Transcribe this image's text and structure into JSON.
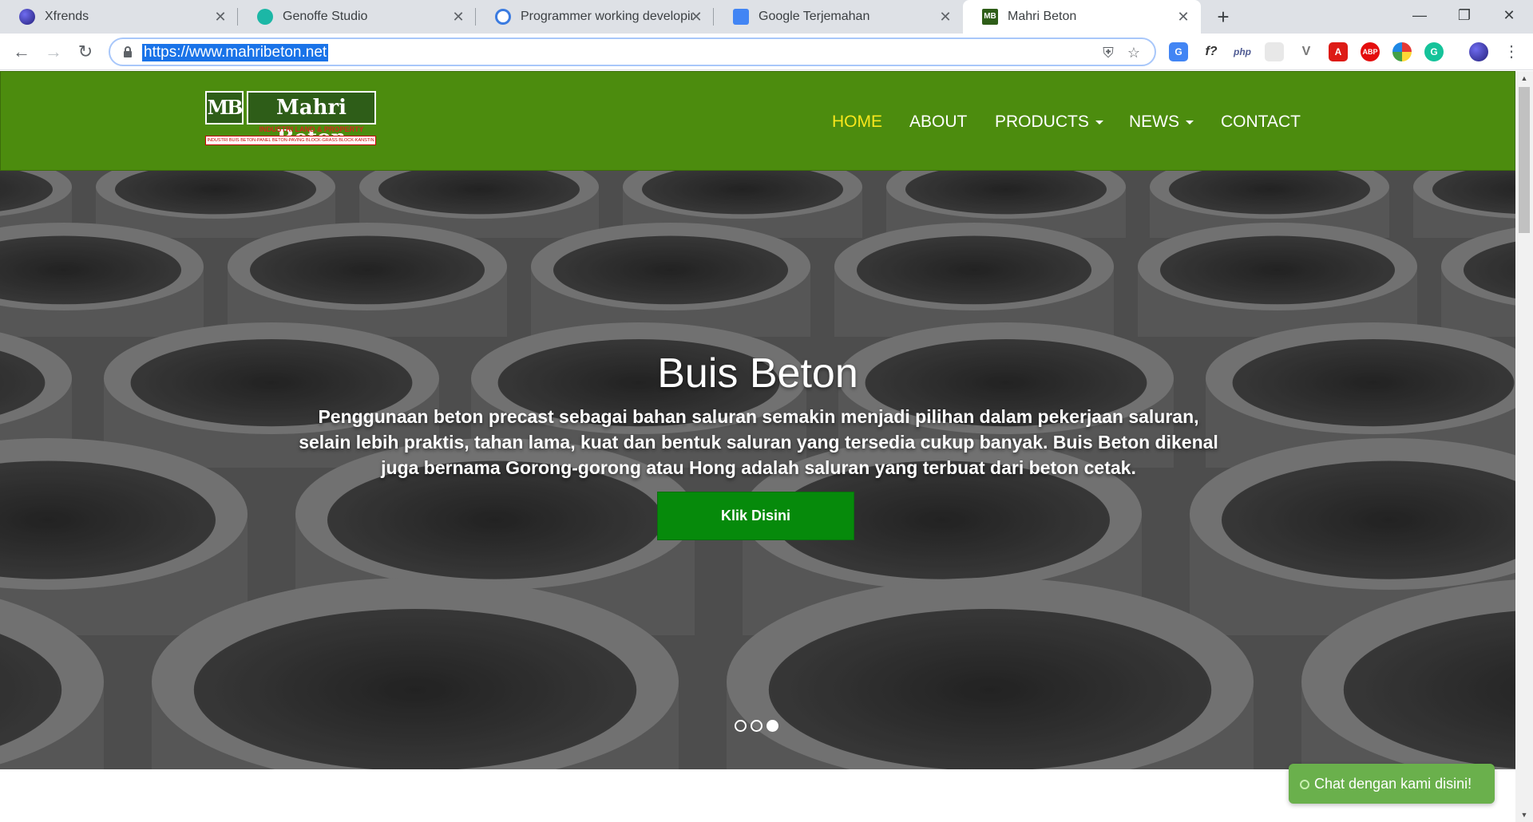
{
  "browser": {
    "tabs": [
      {
        "title": "Xfrends",
        "icon": "globe-icon",
        "active": false
      },
      {
        "title": "Genoffe Studio",
        "icon": "genoffe-icon",
        "active": false
      },
      {
        "title": "Programmer working developing",
        "icon": "gear-bug-icon",
        "active": false
      },
      {
        "title": "Google Terjemahan",
        "icon": "translate-icon",
        "active": false
      },
      {
        "title": "Mahri Beton",
        "icon": "mb-favicon",
        "active": true
      }
    ],
    "new_tab": "+",
    "window_controls": {
      "minimize": "—",
      "maximize": "❐",
      "close": "✕"
    },
    "address_bar": {
      "url": "https://www.mahribeton.net"
    },
    "nav": {
      "back": "←",
      "forward": "→",
      "reload": "↻"
    },
    "extensions": [
      {
        "name": "translate-extension-icon",
        "label": "G"
      },
      {
        "name": "formula-extension-icon",
        "label": "f?"
      },
      {
        "name": "php-extension-icon",
        "label": "php"
      },
      {
        "name": "blank-extension-icon",
        "label": ""
      },
      {
        "name": "vuetify-extension-icon",
        "label": "V"
      },
      {
        "name": "angular-extension-icon",
        "label": "A"
      },
      {
        "name": "adblock-extension-icon",
        "label": "ABP"
      },
      {
        "name": "palette-extension-icon",
        "label": ""
      },
      {
        "name": "grammarly-extension-icon",
        "label": "G"
      },
      {
        "name": "profile-avatar-icon",
        "label": ""
      }
    ]
  },
  "site": {
    "logo": {
      "mark": "MB",
      "name": "Mahri Beton",
      "tagline": "INDUSTRI LAND & PROPERTY",
      "products_line": "INDUSTRI BUIS BETON-PANEL BETON-PAVING BLOCK-GRASS BLOCK-KANSTIN"
    },
    "nav": [
      {
        "label": "HOME",
        "active": true,
        "dropdown": false
      },
      {
        "label": "ABOUT",
        "active": false,
        "dropdown": false
      },
      {
        "label": "PRODUCTS",
        "active": false,
        "dropdown": true
      },
      {
        "label": "NEWS",
        "active": false,
        "dropdown": true
      },
      {
        "label": "CONTACT",
        "active": false,
        "dropdown": false
      }
    ],
    "hero": {
      "title": "Buis Beton",
      "text": "Penggunaan beton precast sebagai bahan saluran semakin menjadi pilihan dalam pekerjaan saluran, selain lebih praktis, tahan lama, kuat dan bentuk saluran yang tersedia cukup banyak. Buis Beton dikenal juga bernama Gorong-gorong atau Hong adalah saluran yang terbuat dari beton cetak.",
      "button": "Klik Disini",
      "slides": 3,
      "active_slide": 3
    },
    "chat": {
      "label": "Chat dengan kami disini!"
    }
  },
  "colors": {
    "header_green": "#4c8c0e",
    "nav_active": "#f8e71c",
    "button_green": "#068a0b",
    "chat_green": "#6ab04c"
  }
}
